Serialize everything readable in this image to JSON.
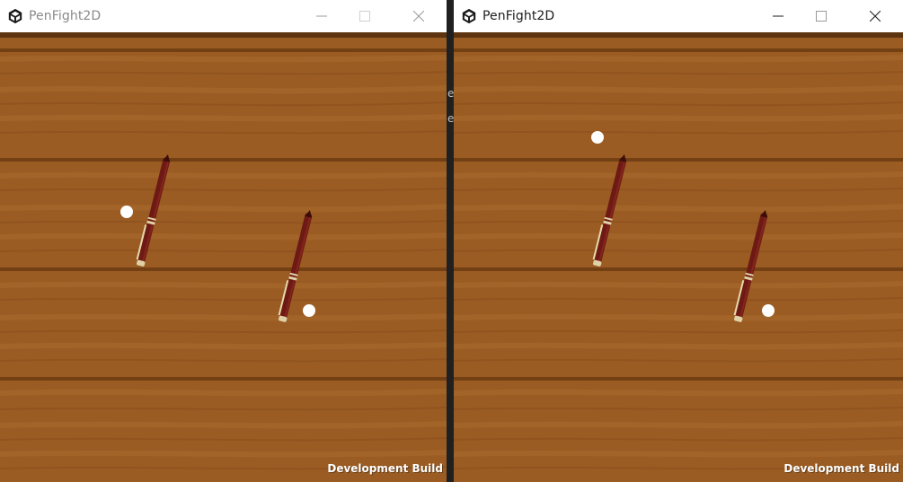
{
  "windows": [
    {
      "id": "left",
      "title": "PenFight2D",
      "active": false,
      "dev_build_label": "Development Build",
      "icon": "unity-logo-icon"
    },
    {
      "id": "right",
      "title": "PenFight2D",
      "active": true,
      "dev_build_label": "Development Build",
      "icon": "unity-logo-icon"
    }
  ],
  "window_controls": [
    "minimize-icon",
    "maximize-icon",
    "close-icon"
  ],
  "background_gap_glyphs": [
    "e",
    "e"
  ],
  "colors": {
    "wood": "#9a5c23",
    "wood_dark_line": "#7a4617",
    "wood_light_streak": "#aa6a2e",
    "pen_body": "#6e1a14",
    "pen_trim": "#d8c89a",
    "marker": "#ffffff",
    "divider": "#202020"
  }
}
